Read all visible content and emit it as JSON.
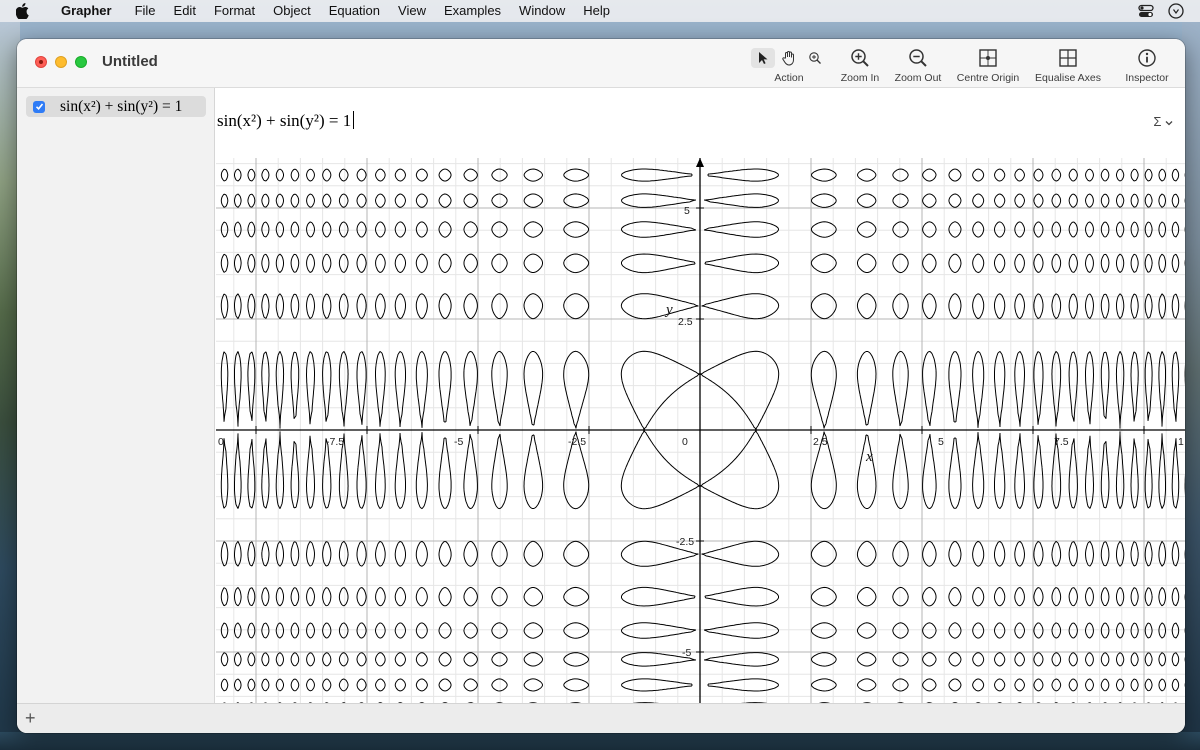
{
  "menubar": {
    "app_name": "Grapher",
    "items": [
      "File",
      "Edit",
      "Format",
      "Object",
      "Equation",
      "View",
      "Examples",
      "Window",
      "Help"
    ]
  },
  "window": {
    "title": "Untitled"
  },
  "toolbar": {
    "action_label": "Action",
    "zoom_in_label": "Zoom In",
    "zoom_out_label": "Zoom Out",
    "centre_origin_label": "Centre Origin",
    "equalise_axes_label": "Equalise Axes",
    "inspector_label": "Inspector"
  },
  "sidebar": {
    "equations": [
      {
        "expr": "sin(x²) + sin(y²) = 1",
        "checked": true
      }
    ]
  },
  "editor": {
    "expression": "sin(x²) + sin(y²) = 1",
    "sigma_label": "Σ"
  },
  "bottombar": {
    "add_label": "+"
  },
  "graph": {
    "x_axis_label": "x",
    "y_axis_label": "y",
    "x_ticks": [
      "0",
      "-7.5",
      "-5",
      "-2.5",
      "0",
      "2.5",
      "5",
      "7.5",
      "1"
    ],
    "y_ticks": [
      "5",
      "2.5",
      "-2.5",
      "-5"
    ]
  },
  "colors": {
    "accent": "#2f7cf6",
    "curve": "#000000",
    "grid_major": "#b5b5b5",
    "grid_minor": "#e6e6e6"
  }
}
